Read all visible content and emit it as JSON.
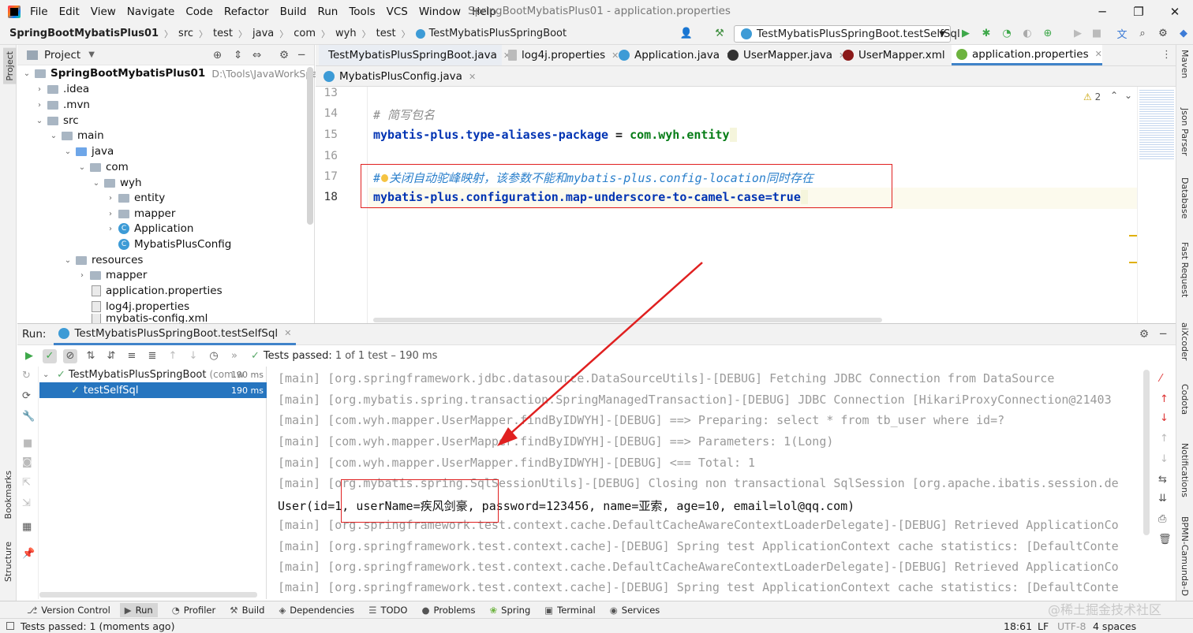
{
  "menu": [
    "File",
    "Edit",
    "View",
    "Navigate",
    "Code",
    "Refactor",
    "Build",
    "Run",
    "Tools",
    "VCS",
    "Window",
    "Help"
  ],
  "window_title": "SpringBootMybatisPlus01 - application.properties",
  "breadcrumb": [
    "SpringBootMybatisPlus01",
    "src",
    "test",
    "java",
    "com",
    "wyh",
    "test",
    "TestMybatisPlusSpringBoot"
  ],
  "run_config": "TestMybatisPlusSpringBoot.testSelfSql",
  "project_panel": {
    "title": "Project",
    "root": "SpringBootMybatisPlus01",
    "root_path": "D:\\Tools\\JavaWorkSpace\\Sprin",
    "items": [
      ".idea",
      ".mvn",
      "src",
      "main",
      "java",
      "com",
      "wyh",
      "entity",
      "mapper",
      "Application",
      "MybatisPlusConfig",
      "resources",
      "mapper",
      "application.properties",
      "log4j.properties",
      "mybatis-config.xml"
    ]
  },
  "editor_tabs_row1": [
    "TestMybatisPlusSpringBoot.java",
    "log4j.properties",
    "Application.java",
    "UserMapper.java",
    "UserMapper.xml",
    "application.properties"
  ],
  "editor_tabs_row2": [
    "MybatisPlusConfig.java"
  ],
  "warning_count": "2",
  "code": {
    "line_numbers": [
      "13",
      "14",
      "15",
      "16",
      "17",
      "18"
    ],
    "comment1": "# 简写包名",
    "l15_key": "mybatis-plus.type-aliases-package",
    "l15_eq": " = ",
    "l15_val": "com.wyh.entity",
    "comment2_a": "#",
    "comment2_b": "关闭自动驼峰映射，该参数不能和mybatis-plus.config-location同时存在",
    "l18": "mybatis-plus.configuration.map-underscore-to-camel-case=true"
  },
  "run_panel": {
    "label": "Run:",
    "tab": "TestMybatisPlusSpringBoot.testSelfSql",
    "tests_passed": "Tests passed:",
    "tests_count": "1 of 1 test – 190 ms",
    "suite_name": "TestMybatisPlusSpringBoot",
    "suite_pkg": "(com.w",
    "suite_time": "190 ms",
    "test_name": "testSelfSql",
    "test_time": "190 ms"
  },
  "console_lines": [
    "[main] [org.springframework.jdbc.datasource.DataSourceUtils]-[DEBUG] Fetching JDBC Connection from DataSource",
    "[main] [org.mybatis.spring.transaction.SpringManagedTransaction]-[DEBUG] JDBC Connection [HikariProxyConnection@21403",
    "[main] [com.wyh.mapper.UserMapper.findByIDWYH]-[DEBUG] ==>  Preparing: select * from tb_user where id=?",
    "[main] [com.wyh.mapper.UserMapper.findByIDWYH]-[DEBUG] ==> Parameters: 1(Long)",
    "[main] [com.wyh.mapper.UserMapper.findByIDWYH]-[DEBUG] <==      Total: 1",
    "[main] [org.mybatis.spring.SqlSessionUtils]-[DEBUG] Closing non transactional SqlSession [org.apache.ibatis.session.de",
    "User(id=1, userName=疾风剑豪, password=123456, name=亚索, age=10, email=lol@qq.com)",
    "[main] [org.springframework.test.context.cache.DefaultCacheAwareContextLoaderDelegate]-[DEBUG] Retrieved ApplicationCo",
    "[main] [org.springframework.test.context.cache]-[DEBUG] Spring test ApplicationContext cache statistics: [DefaultConte",
    "[main] [org.springframework.test.context.cache.DefaultCacheAwareContextLoaderDelegate]-[DEBUG] Retrieved ApplicationCo",
    "[main] [org.springframework.test.context.cache]-[DEBUG] Spring test ApplicationContext cache statistics: [DefaultConte"
  ],
  "tool_windows": [
    "Version Control",
    "Run",
    "Profiler",
    "Build",
    "Dependencies",
    "TODO",
    "Problems",
    "Spring",
    "Terminal",
    "Services"
  ],
  "left_stripe": [
    "Project",
    "Bookmarks",
    "Structure"
  ],
  "right_stripe": [
    "Maven",
    "Json Parser",
    "Database",
    "Fast Request",
    "aiXcoder",
    "Codota",
    "Notifications",
    "BPMN-Camunda-D"
  ],
  "status": {
    "message": "Tests passed: 1 (moments ago)",
    "position": "18:61",
    "line_sep": "LF",
    "encoding": "UTF-8",
    "indent": "4 spaces",
    "watermark": "@稀土掘金技术社区"
  },
  "colors": {
    "accent": "#4083c9",
    "highlight_box": "#e02020",
    "pass": "#59a869",
    "selection": "#2675bf"
  }
}
